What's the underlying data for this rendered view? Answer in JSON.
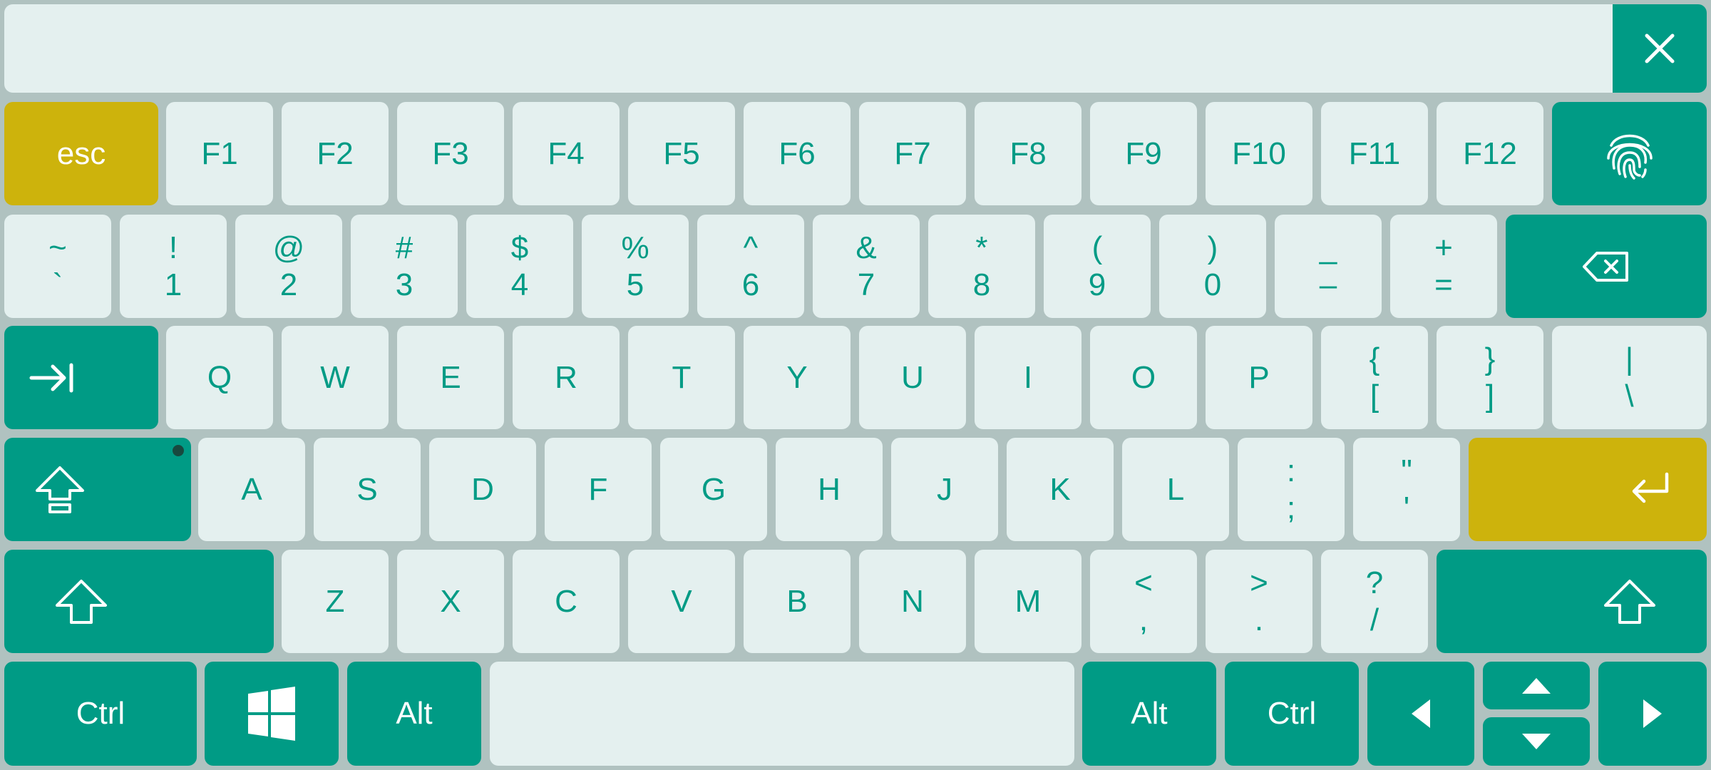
{
  "theme": {
    "key_bg": "#e4f0ef",
    "key_text": "#009b85",
    "mod_bg": "#009b85",
    "accent_bg": "#cdb30c",
    "frame_bg": "#b0c2c0"
  },
  "top_bar": {
    "close_icon": "close-icon"
  },
  "row_function": {
    "esc": "esc",
    "keys": [
      "F1",
      "F2",
      "F3",
      "F4",
      "F5",
      "F6",
      "F7",
      "F8",
      "F9",
      "F10",
      "F11",
      "F12"
    ],
    "fingerprint_icon": "fingerprint-icon"
  },
  "row_number": {
    "keys": [
      {
        "top": "~",
        "bottom": "`"
      },
      {
        "top": "!",
        "bottom": "1"
      },
      {
        "top": "@",
        "bottom": "2"
      },
      {
        "top": "#",
        "bottom": "3"
      },
      {
        "top": "$",
        "bottom": "4"
      },
      {
        "top": "%",
        "bottom": "5"
      },
      {
        "top": "^",
        "bottom": "6"
      },
      {
        "top": "&",
        "bottom": "7"
      },
      {
        "top": "*",
        "bottom": "8"
      },
      {
        "top": "(",
        "bottom": "9"
      },
      {
        "top": ")",
        "bottom": "0"
      },
      {
        "top": "_",
        "bottom": "–"
      },
      {
        "top": "+",
        "bottom": "="
      }
    ],
    "backspace_icon": "backspace-icon"
  },
  "row_q": {
    "tab_icon": "tab-icon",
    "keys": [
      "Q",
      "W",
      "E",
      "R",
      "T",
      "Y",
      "U",
      "I",
      "O",
      "P"
    ],
    "symbols": [
      {
        "top": "{",
        "bottom": "["
      },
      {
        "top": "}",
        "bottom": "]"
      },
      {
        "top": "|",
        "bottom": "\\"
      }
    ]
  },
  "row_a": {
    "caps_icon": "caps-lock-icon",
    "keys": [
      "A",
      "S",
      "D",
      "F",
      "G",
      "H",
      "J",
      "K",
      "L"
    ],
    "symbols": [
      {
        "top": ":",
        "bottom": ";"
      },
      {
        "top": "\"",
        "bottom": "'"
      }
    ],
    "enter_icon": "enter-icon"
  },
  "row_z": {
    "shift_icon": "shift-icon",
    "keys": [
      "Z",
      "X",
      "C",
      "V",
      "B",
      "N",
      "M"
    ],
    "symbols": [
      {
        "top": "<",
        "bottom": ","
      },
      {
        "top": ">",
        "bottom": "."
      },
      {
        "top": "?",
        "bottom": "/"
      }
    ]
  },
  "row_bottom": {
    "ctrl_left": "Ctrl",
    "windows_icon": "windows-icon",
    "alt_left": "Alt",
    "alt_right": "Alt",
    "ctrl_right": "Ctrl",
    "left_icon": "arrow-left-icon",
    "up_icon": "arrow-up-icon",
    "down_icon": "arrow-down-icon",
    "right_icon": "arrow-right-icon"
  }
}
